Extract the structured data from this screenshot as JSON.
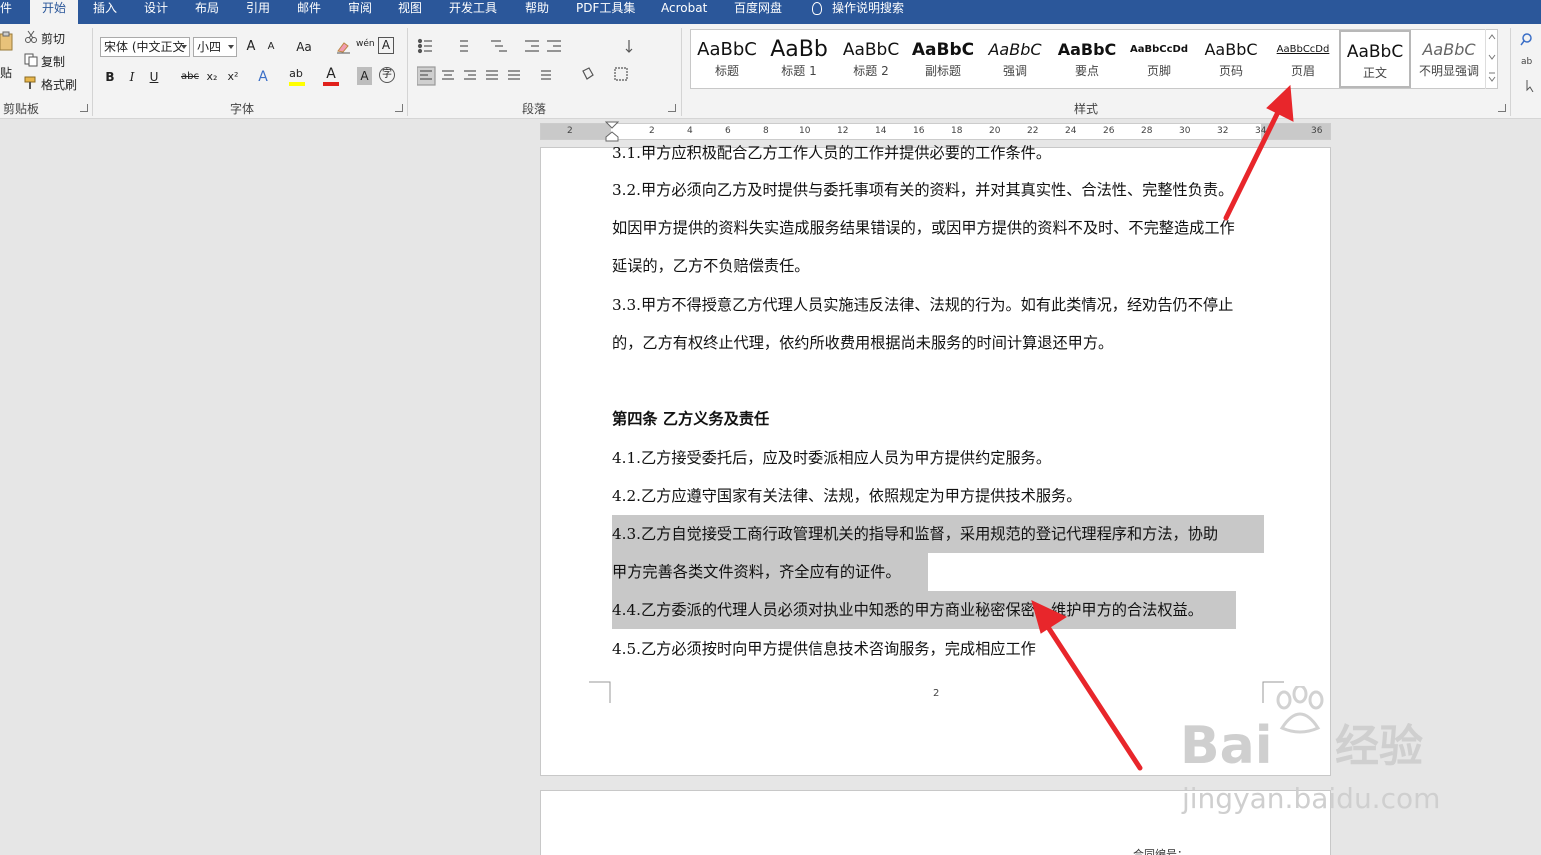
{
  "tabs": [
    {
      "label": "件",
      "active": false
    },
    {
      "label": "开始",
      "active": true
    },
    {
      "label": "插入",
      "active": false
    },
    {
      "label": "设计",
      "active": false
    },
    {
      "label": "布局",
      "active": false
    },
    {
      "label": "引用",
      "active": false
    },
    {
      "label": "邮件",
      "active": false
    },
    {
      "label": "审阅",
      "active": false
    },
    {
      "label": "视图",
      "active": false
    },
    {
      "label": "开发工具",
      "active": false
    },
    {
      "label": "帮助",
      "active": false
    },
    {
      "label": "PDF工具集",
      "active": false
    },
    {
      "label": "Acrobat",
      "active": false
    },
    {
      "label": "百度网盘",
      "active": false
    }
  ],
  "tell_me": "操作说明搜索",
  "clipboard": {
    "paste": "贴",
    "cut": "剪切",
    "copy": "复制",
    "format_painter": "格式刷",
    "group_label": "剪贴板"
  },
  "font": {
    "name": "宋体 (中文正文",
    "size": "小四",
    "grow": "A",
    "shrink": "A",
    "change_case": "Aa",
    "phonetic": "wén",
    "char_border": "A",
    "bold": "B",
    "italic": "I",
    "underline": "U",
    "strikethrough": "abc",
    "subscript": "x₂",
    "superscript": "x²",
    "text_effect": "A",
    "highlight": "ab",
    "font_color": "A",
    "char_shading": "A",
    "enclose": "字",
    "group_label": "字体",
    "font_color_hex": "#e0201b",
    "highlight_hex": "#ffff00"
  },
  "paragraph": {
    "group_label": "段落"
  },
  "styles": {
    "group_label": "样式",
    "items": [
      {
        "sample": "AaBbC",
        "name": "标题"
      },
      {
        "sample": "AaBb",
        "name": "标题 1"
      },
      {
        "sample": "AaBbC",
        "name": "标题 2"
      },
      {
        "sample": "AaBbC",
        "name": "副标题"
      },
      {
        "sample": "AaBbC",
        "name": "强调"
      },
      {
        "sample": "AaBbC",
        "name": "要点"
      },
      {
        "sample": "AaBbCcDd",
        "name": "页脚"
      },
      {
        "sample": "AaBbC",
        "name": "页码"
      },
      {
        "sample": "AaBbCcDd",
        "name": "页眉"
      },
      {
        "sample": "AaBbC",
        "name": "正文"
      },
      {
        "sample": "AaBbC",
        "name": "不明显强调"
      }
    ]
  },
  "ruler": {
    "ticks": [
      "2",
      "2",
      "4",
      "6",
      "8",
      "10",
      "12",
      "14",
      "16",
      "18",
      "20",
      "22",
      "24",
      "26",
      "28",
      "30",
      "32",
      "34",
      "36"
    ]
  },
  "document": {
    "lines": [
      {
        "text": "3.1.甲方应积极配合乙方工作人员的工作并提供必要的工作条件。",
        "style": "normal"
      },
      {
        "text": "3.2.甲方必须向乙方及时提供与委托事项有关的资料，并对其真实性、合法性、完整性负责。",
        "style": "normal"
      },
      {
        "text": "如因甲方提供的资料失实造成服务结果错误的，或因甲方提供的资料不及时、不完整造成工作",
        "style": "normal"
      },
      {
        "text": "延误的，乙方不负赔偿责任。",
        "style": "normal"
      },
      {
        "text": "3.3.甲方不得授意乙方代理人员实施违反法律、法规的行为。如有此类情况，经劝告仍不停止",
        "style": "normal"
      },
      {
        "text": "的，乙方有权终止代理，依约所收费用根据尚未服务的时间计算退还甲方。",
        "style": "normal"
      },
      {
        "text": "第四条 乙方义务及责任",
        "style": "heading"
      },
      {
        "text": "4.1.乙方接受委托后，应及时委派相应人员为甲方提供约定服务。",
        "style": "normal"
      },
      {
        "text": "4.2.乙方应遵守国家有关法律、法规，依照规定为甲方提供技术服务。",
        "style": "normal"
      },
      {
        "text": "4.3.乙方自觉接受工商行政管理机关的指导和监督，采用规范的登记代理程序和方法，协助",
        "style": "selected"
      },
      {
        "text": "甲方完善各类文件资料，齐全应有的证件。",
        "style": "selected"
      },
      {
        "text": "4.4.乙方委派的代理人员必须对执业中知悉的甲方商业秘密保密，维护甲方的合法权益。",
        "style": "selected"
      },
      {
        "text": "4.5.乙方必须按时向甲方提供信息技术咨询服务，完成相应工作",
        "style": "normal"
      }
    ],
    "page_number": "2",
    "next_page_text": "合同编号："
  },
  "watermark": {
    "brand": "Bai",
    "brand_cn": "经验",
    "url": "jingyan.baidu.com"
  },
  "annotation_color": "#e8262b"
}
